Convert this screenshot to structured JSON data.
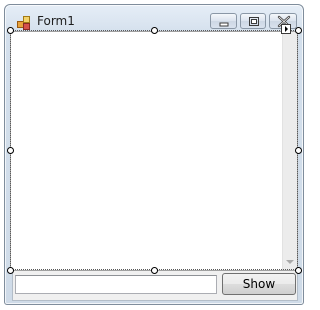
{
  "window": {
    "title": "Form1"
  },
  "titlebar": {
    "icon": "form-app-icon",
    "buttons": {
      "minimize": "minimize-icon",
      "maximize": "maximize-icon",
      "close": "close-icon"
    }
  },
  "designer": {
    "selected_control": "listbox",
    "smart_tag": "smart-tag-arrow-icon"
  },
  "listbox": {
    "items": []
  },
  "textbox": {
    "value": "",
    "placeholder": ""
  },
  "show_button": {
    "label": "Show"
  },
  "colors": {
    "frame": "#cfdbe8",
    "client": "#f0f0f0",
    "list_background": "#ffffff",
    "button_border": "#707070"
  }
}
